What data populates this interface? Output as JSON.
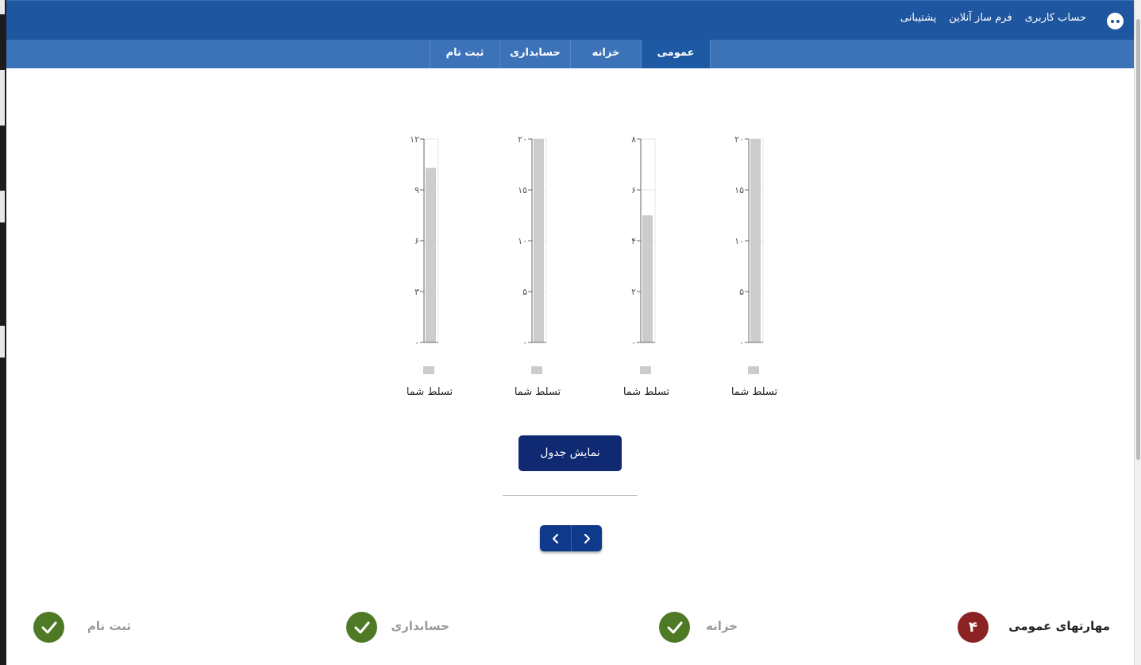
{
  "header": {
    "links": [
      "حساب کاربری",
      "فرم ساز آنلاین",
      "پشتیبانی"
    ],
    "user_icon": "user-face-icon"
  },
  "nav": {
    "tabs": [
      {
        "label": "عمومی",
        "active": true
      },
      {
        "label": "خزانه",
        "active": false
      },
      {
        "label": "حسابداری",
        "active": false
      },
      {
        "label": "ثبت نام",
        "active": false
      }
    ]
  },
  "chart_data": [
    {
      "type": "bar",
      "categories": [
        ""
      ],
      "series": [
        {
          "name": "تسلط شما",
          "values": [
            20
          ]
        }
      ],
      "ylim": [
        0,
        20
      ],
      "yticks": [
        "۰",
        "۵",
        "۱۰",
        "۱۵",
        "۲۰"
      ],
      "color": "#cccccc"
    },
    {
      "type": "bar",
      "categories": [
        ""
      ],
      "series": [
        {
          "name": "تسلط شما",
          "values": [
            5
          ]
        }
      ],
      "ylim": [
        0,
        8
      ],
      "yticks": [
        "۰",
        "۲",
        "۴",
        "۶",
        "۸"
      ],
      "color": "#cccccc"
    },
    {
      "type": "bar",
      "categories": [
        ""
      ],
      "series": [
        {
          "name": "تسلط شما",
          "values": [
            20
          ]
        }
      ],
      "ylim": [
        0,
        20
      ],
      "yticks": [
        "۰",
        "۵",
        "۱۰",
        "۱۵",
        "۲۰"
      ],
      "color": "#cccccc"
    },
    {
      "type": "bar",
      "categories": [
        ""
      ],
      "series": [
        {
          "name": "تسلط شما",
          "values": [
            10.3
          ]
        }
      ],
      "ylim": [
        0,
        12
      ],
      "yticks": [
        "۰",
        "۳",
        "۶",
        "۹",
        "۱۲"
      ],
      "color": "#cccccc"
    }
  ],
  "actions": {
    "table_button": "نمایش جدول",
    "prev_icon": "chevron-left-icon",
    "next_icon": "chevron-right-icon"
  },
  "steps": [
    {
      "label": "مهارتهای عمومی",
      "status": "current",
      "number": "۴"
    },
    {
      "label": "خزانه",
      "status": "done"
    },
    {
      "label": "حسابداری",
      "status": "done"
    },
    {
      "label": "ثبت نام",
      "status": "done"
    }
  ],
  "colors": {
    "header": "#1f56a0",
    "nav": "#3c72b8",
    "nav_active": "#1d5aa3",
    "button": "#0f2a73",
    "step_done": "#4e7a25",
    "step_current": "#8b2324"
  }
}
